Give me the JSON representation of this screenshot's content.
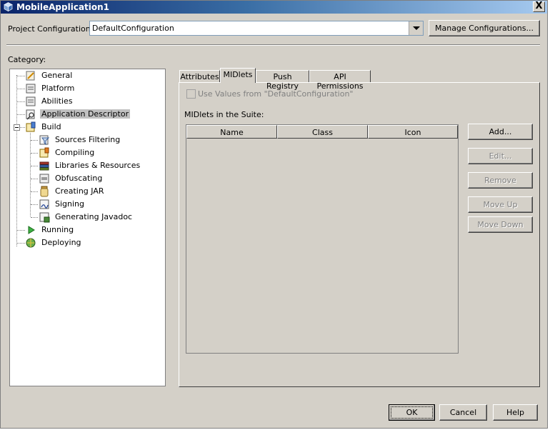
{
  "window": {
    "title": "MobileApplication1",
    "close_label": "X"
  },
  "config": {
    "label": "Project Configuration:",
    "value": "DefaultConfiguration",
    "manage_button": "Manage Configurations..."
  },
  "category_label": "Category:",
  "tree": {
    "general": "General",
    "platform": "Platform",
    "abilities": "Abilities",
    "app_descriptor": "Application Descriptor",
    "build": "Build",
    "sources_filtering": "Sources Filtering",
    "compiling": "Compiling",
    "libraries": "Libraries & Resources",
    "obfuscating": "Obfuscating",
    "creating_jar": "Creating JAR",
    "signing": "Signing",
    "javadoc": "Generating Javadoc",
    "running": "Running",
    "deploying": "Deploying"
  },
  "tabs": {
    "attributes": "Attributes",
    "midlets": "MIDlets",
    "push_registry": "Push Registry",
    "api_permissions": "API Permissions"
  },
  "midlets": {
    "use_values_label": "Use Values from \"DefaultConfiguration\"",
    "suite_label": "MIDlets in the Suite:",
    "columns": {
      "name": "Name",
      "class": "Class",
      "icon": "Icon"
    },
    "buttons": {
      "add": "Add...",
      "edit": "Edit...",
      "remove": "Remove",
      "move_up": "Move Up",
      "move_down": "Move Down"
    }
  },
  "footer": {
    "ok": "OK",
    "cancel": "Cancel",
    "help": "Help"
  }
}
